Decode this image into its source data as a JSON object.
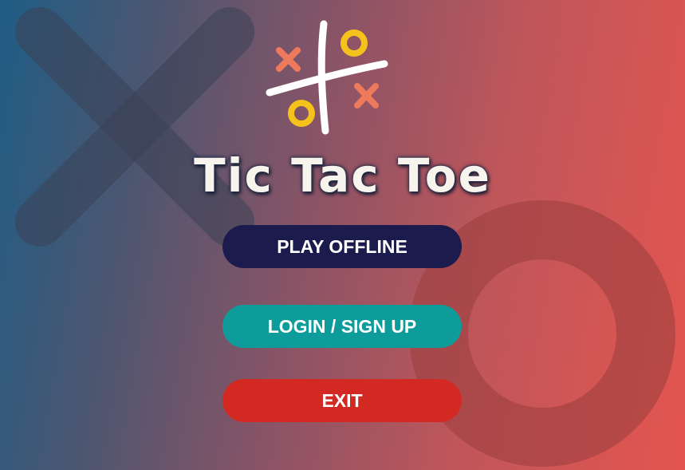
{
  "app": {
    "title": "Tic Tac Toe"
  },
  "menu": {
    "play_offline": "PLAY OFFLINE",
    "login_signup": "LOGIN / SIGN UP",
    "exit": "EXIT"
  },
  "colors": {
    "play_offline_bg": "#1c1b4d",
    "login_bg": "#0e9c9b",
    "exit_bg": "#d22a23",
    "logo_x": "#ee7a5e",
    "logo_o": "#f5c21c",
    "gradient_left": "#1f5d85",
    "gradient_right": "#e4554f"
  },
  "icons": {
    "logo": "tic-tac-toe-logo-icon",
    "background_x": "big-x-icon",
    "background_o": "big-o-icon"
  }
}
